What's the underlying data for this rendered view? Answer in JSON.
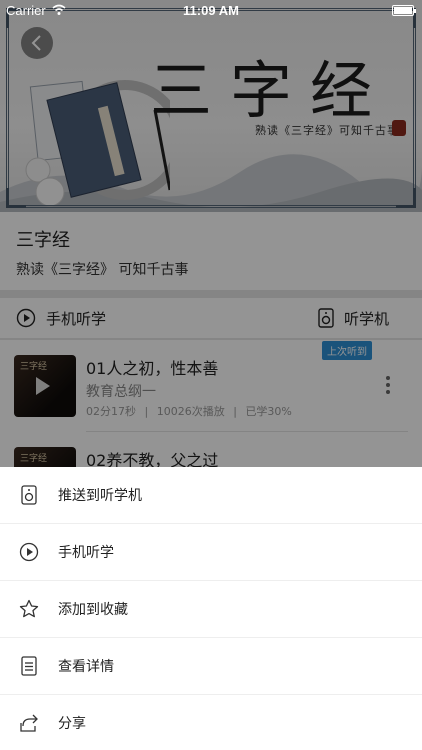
{
  "status_bar": {
    "carrier": "Carrier",
    "time": "11:09 AM"
  },
  "banner": {
    "title": "三字经",
    "subtitle": "熟读《三字经》可知千古事"
  },
  "course": {
    "title": "三字经",
    "subtitle": "熟读《三字经》 可知千古事"
  },
  "actions": {
    "phone_listen": "手机听学",
    "listen_machine": "听学机"
  },
  "episodes": [
    {
      "thumb_text": "三字经",
      "title": "01人之初，性本善",
      "chapter": "教育总纲一",
      "duration": "02分17秒",
      "plays": "10026次播放",
      "progress": "已学30%",
      "badge": "上次听到"
    },
    {
      "thumb_text": "三字经",
      "title": "02养不教，父之过"
    }
  ],
  "meta_separator": "|",
  "sheet": {
    "items": [
      {
        "icon": "speaker-icon",
        "label": "推送到听学机"
      },
      {
        "icon": "play-circle-icon",
        "label": "手机听学"
      },
      {
        "icon": "star-icon",
        "label": "添加到收藏"
      },
      {
        "icon": "document-icon",
        "label": "查看详情"
      },
      {
        "icon": "share-icon",
        "label": "分享"
      }
    ]
  },
  "colors": {
    "badge_blue": "#2d8fd5",
    "overlay": "rgba(0,0,0,0.42)"
  }
}
